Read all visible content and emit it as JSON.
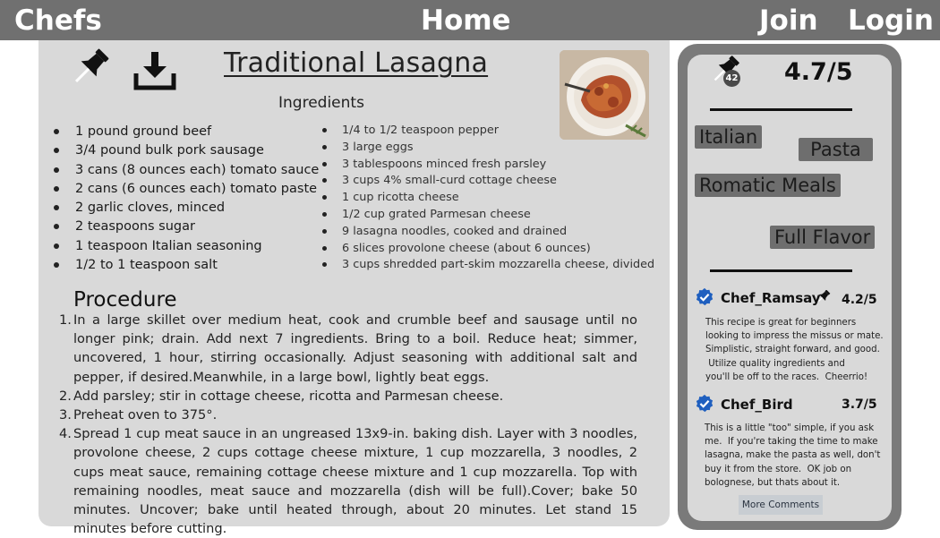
{
  "nav": {
    "chefs": "Chefs",
    "home": "Home",
    "join": "Join",
    "login": "Login"
  },
  "recipe": {
    "title": "Traditional Lasagna",
    "ingredients_heading": "Ingredients",
    "ingredients_left": [
      "1 pound ground beef",
      "3/4 pound bulk pork sausage",
      "3 cans (8 ounces each) tomato sauce",
      "2 cans (6 ounces each) tomato paste",
      "2 garlic cloves, minced",
      "2 teaspoons sugar",
      "1 teaspoon Italian seasoning",
      "1/2 to 1 teaspoon salt"
    ],
    "ingredients_right": [
      "1/4 to 1/2 teaspoon pepper",
      "3 large eggs",
      "3 tablespoons minced fresh parsley",
      "3 cups 4% small-curd cottage cheese",
      "1 cup ricotta cheese",
      "1/2 cup grated Parmesan cheese",
      "9 lasagna noodles, cooked and drained",
      "6 slices provolone cheese (about 6 ounces)",
      "3 cups shredded part-skim mozzarella cheese, divided"
    ],
    "procedure_heading": "Procedure",
    "procedure": [
      {
        "num": "1.",
        "text": "In a large skillet over medium heat, cook and crumble beef and sausage until no longer pink; drain. Add next 7 ingredients. Bring to a boil. Reduce heat; simmer, uncovered, 1 hour, stirring occasionally. Adjust seasoning with additional salt and pepper, if desired.Meanwhile, in a large bowl, lightly beat eggs."
      },
      {
        "num": "2.",
        "text": " Add parsley; stir in cottage cheese, ricotta and Parmesan cheese."
      },
      {
        "num": "3.",
        "text": "Preheat oven to 375°."
      },
      {
        "num": "4.",
        "text": "Spread 1 cup meat sauce in an ungreased 13x9-in. baking dish. Layer with 3 noodles, provolone cheese, 2 cups cottage cheese mixture, 1 cup mozzarella, 3 noodles, 2 cups meat sauce, remaining cottage cheese mixture and 1 cup mozzarella. Top with remaining noodles, meat sauce and mozzarella (dish will be full).Cover; bake 50 minutes. Uncover; bake until heated through, about 20 minutes. Let stand 15 minutes before cutting."
      }
    ]
  },
  "sidebar": {
    "pin_count": "42",
    "rating": "4.7/5",
    "tags": [
      "Italian",
      "Pasta",
      "Romatic Meals",
      "Full Flavor"
    ],
    "reviews": [
      {
        "chef": "Chef_Ramsay",
        "rating": "4.2/5",
        "lines": [
          "This recipe is great for beginners",
          "looking to impress the missus or mate.",
          "Simplistic, straight forward, and good.",
          " Utilize quality ingredients and",
          "you'll be off to the races.  Cheerrio!"
        ]
      },
      {
        "chef": "Chef_Bird",
        "rating": "3.7/5",
        "lines": [
          "This is a little \"too\" simple, if you ask",
          "me.  If you're taking the time to make",
          "lasagna, make the pasta as well, don't",
          "buy it from the store.  OK job on",
          "bolognese, but thats about it."
        ]
      }
    ],
    "more_comments": "More Comments"
  },
  "colors": {
    "topbar": "#707070",
    "card": "#d9d9d9",
    "side_frame": "#7a7a7a",
    "tag_bg": "#6e6e6e",
    "verified_badge": "#1f5fbf",
    "more_btn": "#c8cdd2"
  }
}
